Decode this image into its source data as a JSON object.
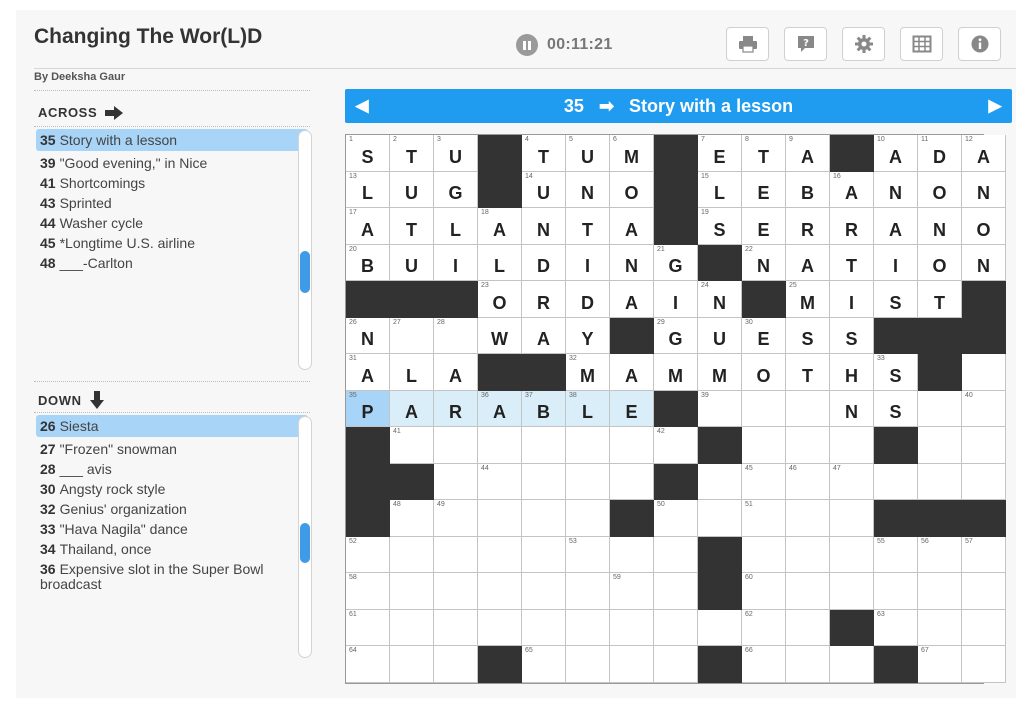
{
  "puzzle": {
    "title": "Changing The Wor(L)D",
    "byline": "By Deeksha Gaur",
    "timer": "00:11:21"
  },
  "toolbar": [
    {
      "name": "print-icon"
    },
    {
      "name": "help-icon"
    },
    {
      "name": "gear-icon"
    },
    {
      "name": "grid-icon"
    },
    {
      "name": "info-icon"
    }
  ],
  "across": {
    "label": "ACROSS",
    "clues": [
      {
        "num": "35",
        "text": "Story with a lesson",
        "selected": true
      },
      {
        "num": "39",
        "text": "\"Good evening,\" in Nice"
      },
      {
        "num": "41",
        "text": "Shortcomings"
      },
      {
        "num": "43",
        "text": "Sprinted"
      },
      {
        "num": "44",
        "text": "Washer cycle"
      },
      {
        "num": "45",
        "text": "*Longtime U.S. airline"
      },
      {
        "num": "48",
        "text": "___-Carlton"
      }
    ]
  },
  "down": {
    "label": "DOWN",
    "clues": [
      {
        "num": "26",
        "text": "Siesta",
        "selected": true
      },
      {
        "num": "27",
        "text": "\"Frozen\" snowman"
      },
      {
        "num": "28",
        "text": "___ avis"
      },
      {
        "num": "30",
        "text": "Angsty rock style"
      },
      {
        "num": "32",
        "text": "Genius' organization"
      },
      {
        "num": "33",
        "text": "\"Hava Nagila\" dance"
      },
      {
        "num": "34",
        "text": "Thailand, once"
      },
      {
        "num": "36",
        "text": "Expensive slot in the Super Bowl broadcast"
      }
    ]
  },
  "clue_bar": {
    "num": "35",
    "direction_glyph": "➡",
    "text": "Story with a lesson",
    "prev_glyph": "◀",
    "next_glyph": "▶"
  },
  "grid": {
    "rows": [
      "STU#TUM#ETA#ADA",
      "LUG#UNO#LEBANON",
      "ATLANTA#SERRANO",
      "BUILDING#NATION",
      "###ORDAIN#MIST#",
      "N..WAY#GUESS###",
      "ALA##MAMMOTHS#.",
      "PARABLE#...NS..",
      "#.......#...#..",
      "##.....#.......",
      "#.....#.....###",
      "........#......",
      "........#......",
      "...........#...",
      "...#....#...#.."
    ],
    "numbers": [
      [
        1,
        2,
        3,
        0,
        4,
        5,
        6,
        0,
        7,
        8,
        9,
        0,
        10,
        11,
        12
      ],
      [
        13,
        0,
        0,
        0,
        14,
        0,
        0,
        0,
        15,
        0,
        0,
        16,
        0,
        0,
        0
      ],
      [
        17,
        0,
        0,
        18,
        0,
        0,
        0,
        0,
        19,
        0,
        0,
        0,
        0,
        0,
        0
      ],
      [
        20,
        0,
        0,
        0,
        0,
        0,
        0,
        21,
        0,
        22,
        0,
        0,
        0,
        0,
        0
      ],
      [
        0,
        0,
        0,
        23,
        0,
        0,
        0,
        0,
        24,
        0,
        25,
        0,
        0,
        0,
        0
      ],
      [
        26,
        27,
        28,
        0,
        0,
        0,
        0,
        29,
        0,
        30,
        0,
        0,
        0,
        0,
        0
      ],
      [
        31,
        0,
        0,
        0,
        0,
        32,
        0,
        0,
        0,
        0,
        0,
        0,
        33,
        34,
        0
      ],
      [
        35,
        0,
        0,
        36,
        37,
        38,
        0,
        0,
        39,
        0,
        0,
        0,
        0,
        0,
        40
      ],
      [
        0,
        41,
        0,
        0,
        0,
        0,
        0,
        42,
        0,
        0,
        0,
        0,
        43,
        0,
        0
      ],
      [
        0,
        0,
        0,
        44,
        0,
        0,
        0,
        0,
        0,
        45,
        46,
        47,
        0,
        0,
        0
      ],
      [
        0,
        48,
        49,
        0,
        0,
        0,
        0,
        50,
        0,
        51,
        0,
        0,
        0,
        0,
        0
      ],
      [
        52,
        0,
        0,
        0,
        0,
        53,
        0,
        0,
        54,
        0,
        0,
        0,
        55,
        56,
        57
      ],
      [
        58,
        0,
        0,
        0,
        0,
        0,
        59,
        0,
        0,
        60,
        0,
        0,
        0,
        0,
        0
      ],
      [
        61,
        0,
        0,
        0,
        0,
        0,
        0,
        0,
        0,
        62,
        0,
        0,
        63,
        0,
        0
      ],
      [
        64,
        0,
        0,
        0,
        65,
        0,
        0,
        0,
        0,
        66,
        0,
        0,
        0,
        67,
        0
      ]
    ],
    "word_cells": [
      [
        7,
        0
      ],
      [
        7,
        1
      ],
      [
        7,
        2
      ],
      [
        7,
        3
      ],
      [
        7,
        4
      ],
      [
        7,
        5
      ],
      [
        7,
        6
      ]
    ],
    "active_cell": [
      7,
      0
    ]
  }
}
